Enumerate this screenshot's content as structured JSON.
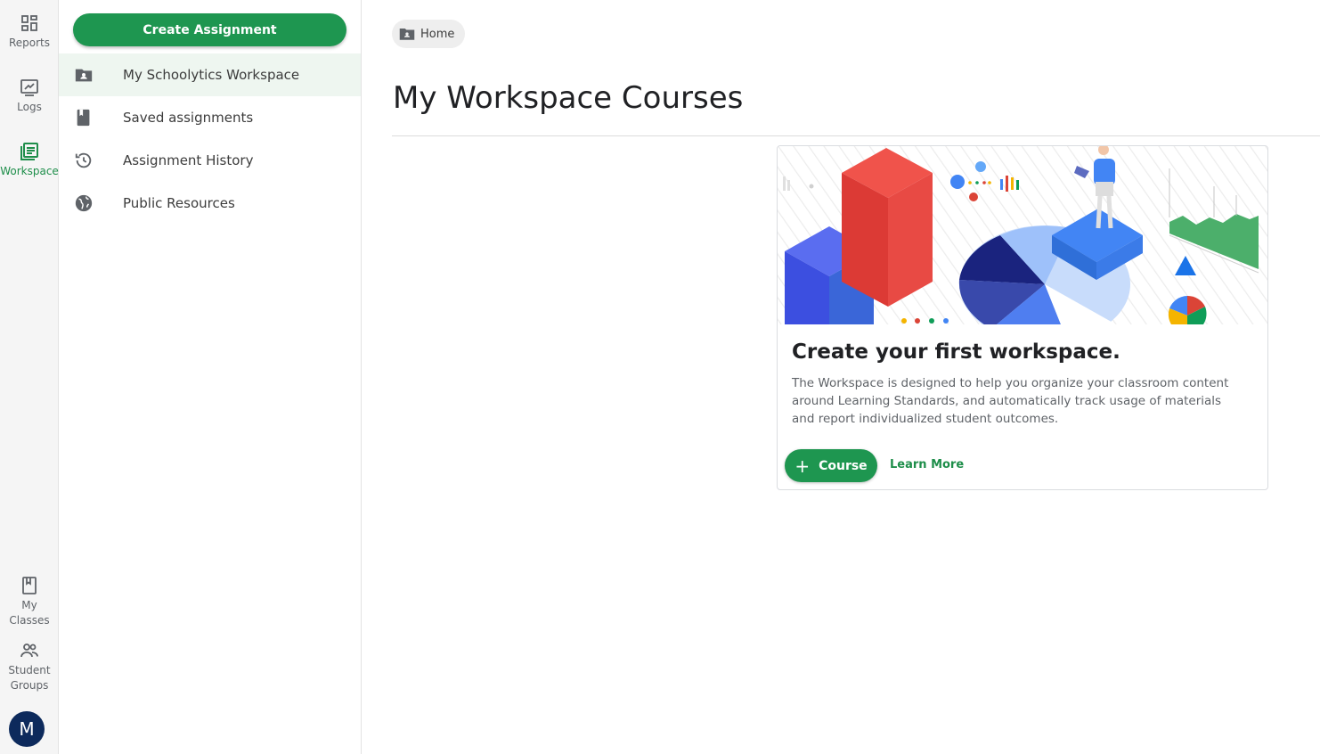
{
  "rail": {
    "reports": "Reports",
    "logs": "Logs",
    "workspace": "Workspace",
    "my_classes_1": "My",
    "my_classes_2": "Classes",
    "student_groups_1": "Student",
    "student_groups_2": "Groups",
    "avatar_initial": "M"
  },
  "subnav": {
    "create_label": "Create Assignment",
    "items": [
      {
        "label": "My Schoolytics Workspace",
        "icon": "folder-person-icon"
      },
      {
        "label": "Saved assignments",
        "icon": "bookmark-book-icon"
      },
      {
        "label": "Assignment History",
        "icon": "history-icon"
      },
      {
        "label": "Public Resources",
        "icon": "globe-icon"
      }
    ]
  },
  "main": {
    "breadcrumb": "Home",
    "title": "My Workspace Courses",
    "card": {
      "heading": "Create your first workspace.",
      "body": "The Workspace is designed to help you organize your classroom content around Learning Standards, and automatically track usage of materials and report individualized student outcomes.",
      "course_label": "Course",
      "learn_more": "Learn More"
    }
  },
  "colors": {
    "accent": "#1e9650",
    "active_text": "#1e8e4a",
    "avatar": "#0d2a5c"
  }
}
